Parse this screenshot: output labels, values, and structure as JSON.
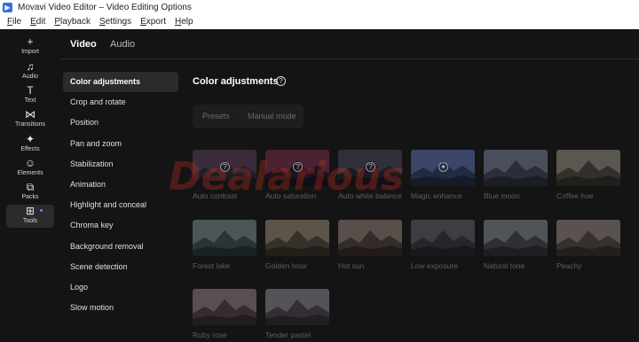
{
  "window": {
    "title": "Movavi Video Editor – Video Editing Options",
    "app_icon": "movavi-logo-icon"
  },
  "menu": [
    {
      "first": "F",
      "rest": "ile"
    },
    {
      "first": "E",
      "rest": "dit"
    },
    {
      "first": "P",
      "rest": "layback"
    },
    {
      "first": "S",
      "rest": "ettings"
    },
    {
      "first": "E",
      "rest": "xport"
    },
    {
      "first": "H",
      "rest": "elp"
    }
  ],
  "rail": [
    {
      "label": "Import",
      "icon": "plus-icon",
      "glyph": "+"
    },
    {
      "label": "Audio",
      "icon": "music-note-icon",
      "glyph": "♫"
    },
    {
      "label": "Text",
      "icon": "text-icon",
      "glyph": "T"
    },
    {
      "label": "Transitions",
      "icon": "transitions-icon",
      "glyph": "⋈"
    },
    {
      "label": "Effects",
      "icon": "sparkle-icon",
      "glyph": "✦"
    },
    {
      "label": "Elements",
      "icon": "smiley-icon",
      "glyph": "☺"
    },
    {
      "label": "Packs",
      "icon": "packs-icon",
      "glyph": "⧉"
    },
    {
      "label": "Tools",
      "icon": "grid-icon",
      "glyph": "⊞"
    }
  ],
  "tabs": {
    "video": "Video",
    "audio": "Audio"
  },
  "submenu": [
    "Color adjustments",
    "Crop and rotate",
    "Position",
    "Pan and zoom",
    "Stabilization",
    "Animation",
    "Highlight and conceal",
    "Chroma key",
    "Background removal",
    "Scene detection",
    "Logo",
    "Slow motion"
  ],
  "panel": {
    "title": "Color adjustments",
    "help_glyph": "?",
    "segments": {
      "presets": "Presets",
      "manual": "Manual mode"
    }
  },
  "presets": [
    {
      "label": "Auto contrast",
      "sky": "#3a2c3a",
      "mountain": "#1e1e28",
      "icon": "?"
    },
    {
      "label": "Auto saturation",
      "sky": "#4a2232",
      "mountain": "#1a1420",
      "icon": "?"
    },
    {
      "label": "Auto white balance",
      "sky": "#30303a",
      "mountain": "#1a1a22",
      "icon": "?"
    },
    {
      "label": "Magic enhance",
      "sky": "#3a4568",
      "mountain": "#222a40",
      "icon": "✦"
    },
    {
      "label": "Blue moon",
      "sky": "#4a4e5c",
      "mountain": "#2a2e38"
    },
    {
      "label": "Coffee hue",
      "sky": "#5a5650",
      "mountain": "#33302c"
    },
    {
      "label": "Forest lake",
      "sky": "#4a5658",
      "mountain": "#2a3436"
    },
    {
      "label": "Golden hour",
      "sky": "#5c5448",
      "mountain": "#36302a"
    },
    {
      "label": "Hot sun",
      "sky": "#584e4a",
      "mountain": "#342c2a"
    },
    {
      "label": "Low exposure",
      "sky": "#3c3e44",
      "mountain": "#24262a"
    },
    {
      "label": "Natural tone",
      "sky": "#505458",
      "mountain": "#2e3034"
    },
    {
      "label": "Peachy",
      "sky": "#5a5250",
      "mountain": "#36302e"
    },
    {
      "label": "Ruby rose",
      "sky": "#5a4e52",
      "mountain": "#342c30"
    },
    {
      "label": "Tender pastel",
      "sky": "#56525a",
      "mountain": "#322e34"
    }
  ],
  "colors": {
    "background": "#141414",
    "accent": "#4e8cff",
    "active_item": "#2b2b2b"
  }
}
